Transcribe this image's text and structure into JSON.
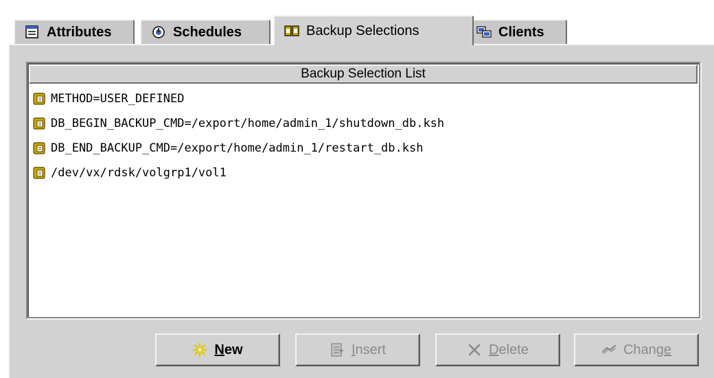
{
  "tabs": [
    {
      "label": "Attributes",
      "icon": "attributes-icon",
      "active": false
    },
    {
      "label": "Schedules",
      "icon": "schedules-icon",
      "active": false
    },
    {
      "label": "Backup Selections",
      "icon": "backup-selections-icon",
      "active": true
    },
    {
      "label": "Clients",
      "icon": "clients-icon",
      "active": false
    }
  ],
  "list": {
    "header": "Backup Selection List",
    "items": [
      {
        "text": "METHOD=USER_DEFINED",
        "icon": "selection-file-icon"
      },
      {
        "text": "DB_BEGIN_BACKUP_CMD=/export/home/admin_1/shutdown_db.ksh",
        "icon": "selection-file-icon"
      },
      {
        "text": "DB_END_BACKUP_CMD=/export/home/admin_1/restart_db.ksh",
        "icon": "selection-file-icon"
      },
      {
        "text": "/dev/vx/rdsk/volgrp1/vol1",
        "icon": "selection-file-icon"
      }
    ]
  },
  "buttons": {
    "new": {
      "mnemonic": "N",
      "rest": "ew",
      "enabled": true,
      "icon": "sparkle-icon"
    },
    "insert": {
      "mnemonic": "I",
      "rest": "nsert",
      "enabled": false,
      "icon": "insert-icon"
    },
    "delete": {
      "mnemonic": "D",
      "rest": "elete",
      "enabled": false,
      "icon": "delete-x-icon"
    },
    "change": {
      "pre": "Chang",
      "mnemonic": "e",
      "enabled": false,
      "icon": "change-icon"
    }
  },
  "colors": {
    "panel_bg": "#d2d2d2",
    "item_icon": "#c8a800",
    "new_icon": "#e8c800"
  }
}
